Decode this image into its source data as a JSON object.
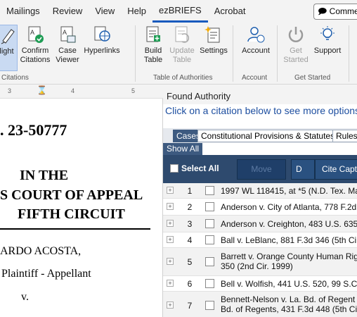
{
  "menu": {
    "tabs": [
      "Mailings",
      "Review",
      "View",
      "Help",
      "ezBRIEFS",
      "Acrobat"
    ],
    "active_tab": "ezBRIEFS",
    "comments_label": "Comme"
  },
  "ribbon": {
    "buttons": {
      "highlight": "light",
      "confirm": [
        "Confirm",
        "Citations"
      ],
      "case_viewer": [
        "Case",
        "Viewer"
      ],
      "hyperlinks": "Hyperlinks",
      "build": [
        "Build",
        "Table"
      ],
      "update": [
        "Update",
        "Table"
      ],
      "settings": "Settings",
      "account": "Account",
      "get_started": [
        "Get",
        "Started"
      ],
      "support": "Support"
    },
    "groups": {
      "citations": "Citations",
      "toa": "Table of Authorities",
      "account": "Account",
      "get_started": "Get Started"
    }
  },
  "ruler": {
    "marks": [
      "3",
      "4",
      "5"
    ]
  },
  "document": {
    "case_no": ". 23-50777",
    "in_the": "IN THE",
    "court": "S COURT OF APPEAL",
    "circuit": "FIFTH CIRCUIT",
    "party": "ARDO ACOSTA,",
    "role": "Plaintiff - Appellant",
    "v": "v."
  },
  "pane": {
    "title": "Found Authority",
    "hint": "Click on a citation below to see more options",
    "filter_tabs": [
      "Cases",
      "Constitutional Provisions & Statutes",
      "Rules &"
    ],
    "show_all": "Show All",
    "select_all": "Select All",
    "toolbar_buttons": [
      "Move",
      "D",
      "Cite Capt"
    ],
    "rows": [
      {
        "num": "1",
        "cite": "1997 WL 118415, at *5 (N.D. Tex. Ma"
      },
      {
        "num": "2",
        "cite": "Anderson v. City of Atlanta, 778 F.2d"
      },
      {
        "num": "3",
        "cite": "Anderson v. Creighton, 483 U.S. 635"
      },
      {
        "num": "4",
        "cite": "Ball v. LeBlanc, 881 F.3d 346 (5th Cir"
      },
      {
        "num": "5",
        "cite": "Barrett v. Orange County Human Rig",
        "cite2": "350 (2nd Cir. 1999)"
      },
      {
        "num": "6",
        "cite": "Bell v. Wolfish, 441 U.S. 520, 99 S.Ct"
      },
      {
        "num": "7",
        "cite": "Bennett-Nelson v. La. Bd. of Regent",
        "cite2": "Bd. of Regents, 431 F.3d 448 (5th Ci"
      }
    ]
  },
  "colors": {
    "accent": "#185abd",
    "pane_bar": "#2e4a6e",
    "hint": "#1e4fa0"
  }
}
